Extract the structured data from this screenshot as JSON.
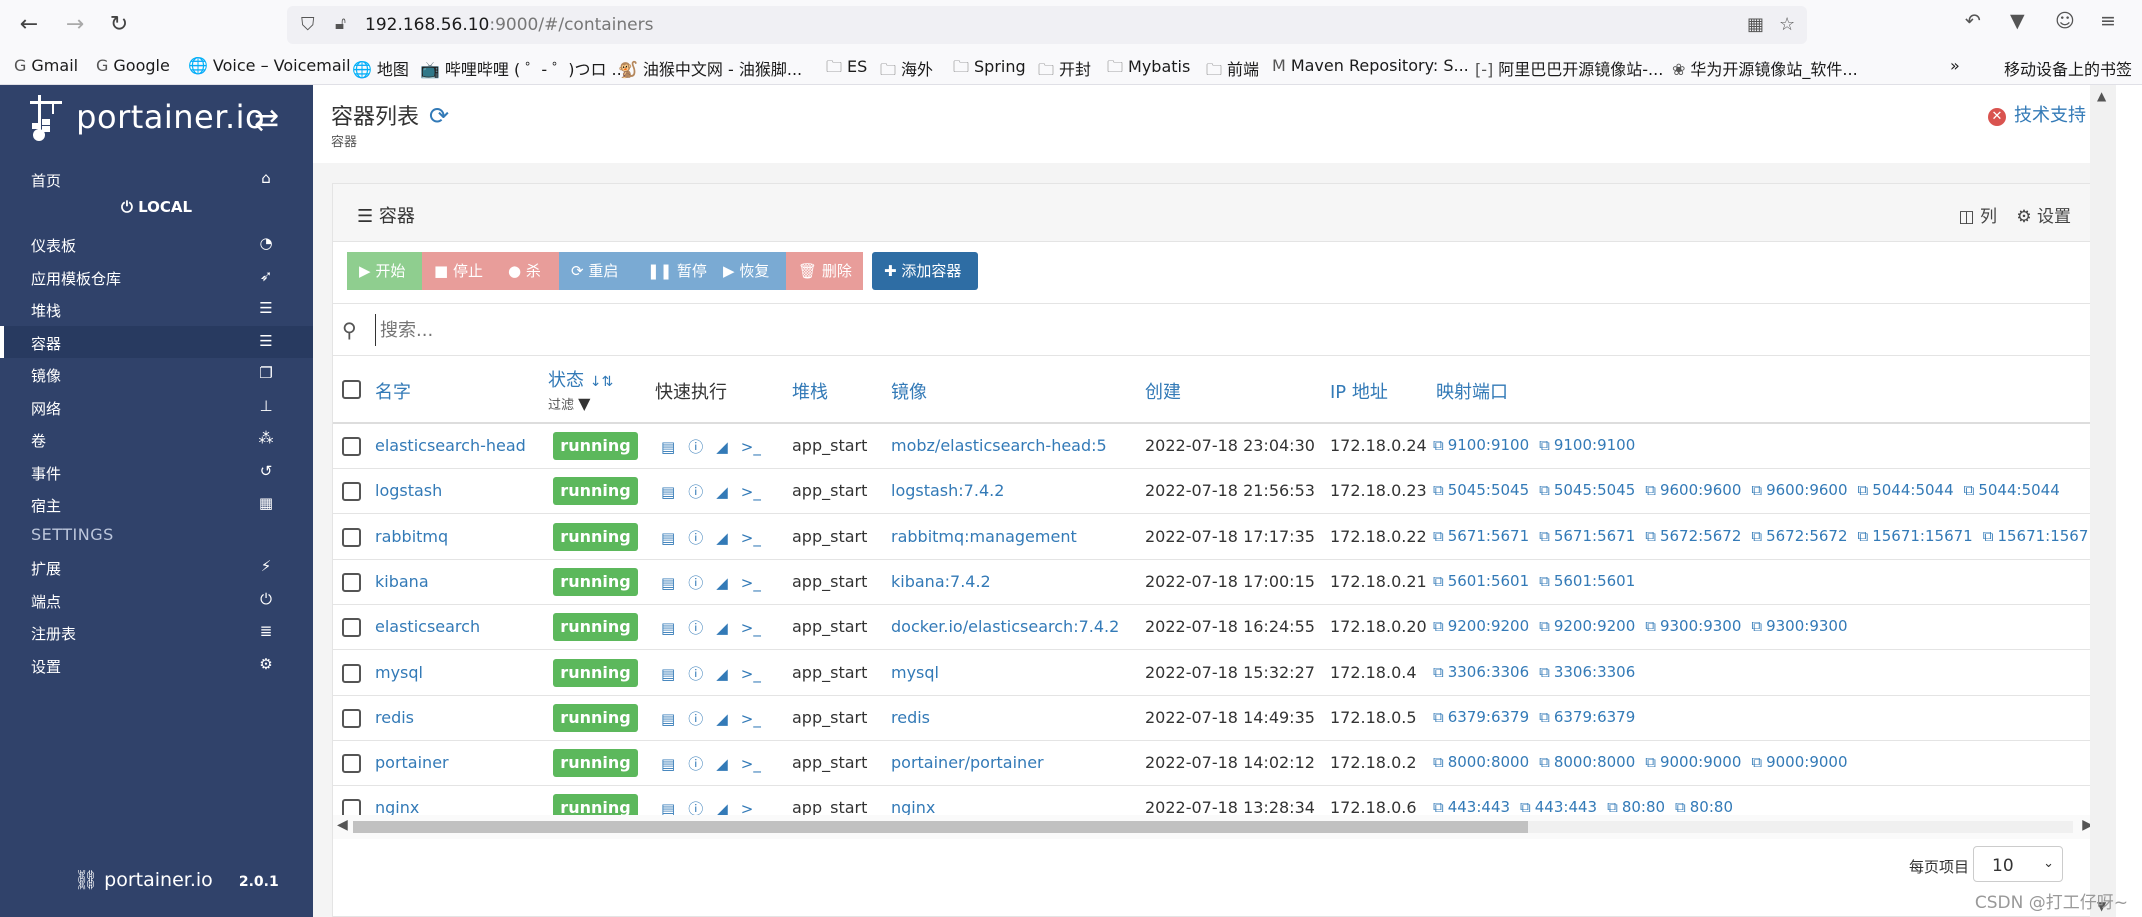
{
  "browser": {
    "url_host": "192.168.56.10",
    "url_rest": ":9000/#/containers",
    "bookmarks": [
      {
        "label": "Gmail",
        "icon": "G"
      },
      {
        "label": "Google",
        "icon": "G"
      },
      {
        "label": "Voice – Voicemail",
        "icon": "🌐"
      },
      {
        "label": "地图",
        "icon": "🌐"
      },
      {
        "label": "哔哩哔哩 ( ゜- ゜)つロ ...",
        "icon": "📺"
      },
      {
        "label": "油猴中文网 - 油猴脚...",
        "icon": "🐒"
      },
      {
        "label": "ES",
        "icon": "🗀"
      },
      {
        "label": "海外",
        "icon": "🗀"
      },
      {
        "label": "Spring",
        "icon": "🗀"
      },
      {
        "label": "开封",
        "icon": "🗀"
      },
      {
        "label": "Mybatis",
        "icon": "🗀"
      },
      {
        "label": "前端",
        "icon": "🗀"
      },
      {
        "label": "Maven Repository: S...",
        "icon": "M"
      },
      {
        "label": "阿里巴巴开源镜像站-...",
        "icon": "[-]"
      },
      {
        "label": "华为开源镜像站_软件...",
        "icon": "❀"
      }
    ],
    "mobile_bookmarks": "移动设备上的书签"
  },
  "sidebar": {
    "logo_text": "portainer.io",
    "home": "首页",
    "endpoint": "LOCAL",
    "items": [
      {
        "label": "仪表板",
        "icon": "dashboard-icon"
      },
      {
        "label": "应用模板仓库",
        "icon": "rocket-icon"
      },
      {
        "label": "堆栈",
        "icon": "list-icon"
      },
      {
        "label": "容器",
        "icon": "server-icon"
      },
      {
        "label": "镜像",
        "icon": "clone-icon"
      },
      {
        "label": "网络",
        "icon": "sitemap-icon"
      },
      {
        "label": "卷",
        "icon": "cubes-icon"
      },
      {
        "label": "事件",
        "icon": "history-icon"
      },
      {
        "label": "宿主",
        "icon": "th-icon"
      }
    ],
    "settings_heading": "SETTINGS",
    "settings_items": [
      {
        "label": "扩展",
        "icon": "bolt-icon"
      },
      {
        "label": "端点",
        "icon": "plug-icon"
      },
      {
        "label": "注册表",
        "icon": "database-icon"
      },
      {
        "label": "设置",
        "icon": "cogs-icon"
      }
    ],
    "footer_logo": "portainer.io",
    "version": "2.0.1"
  },
  "header": {
    "title": "容器列表",
    "subtitle": "容器",
    "support": "技术支持"
  },
  "panel": {
    "title": "容器",
    "columns_btn": "列",
    "settings_btn": "设置",
    "buttons": {
      "start": "开始",
      "stop": "停止",
      "kill": "杀",
      "restart": "重启",
      "pause": "暂停",
      "resume": "恢复",
      "remove": "删除",
      "add": "添加容器"
    },
    "search_placeholder": "搜索...",
    "headers": {
      "name": "名字",
      "state": "状态",
      "filter": "过滤",
      "quick": "快速执行",
      "stack": "堆栈",
      "image": "镜像",
      "created": "创建",
      "ip": "IP 地址",
      "ports": "映射端口"
    },
    "rows": [
      {
        "name": "elasticsearch-head",
        "state": "running",
        "stack": "app_start",
        "image": "mobz/elasticsearch-head:5",
        "created": "2022-07-18 23:04:30",
        "ip": "172.18.0.24",
        "ports": [
          "9100:9100",
          "9100:9100"
        ]
      },
      {
        "name": "logstash",
        "state": "running",
        "stack": "app_start",
        "image": "logstash:7.4.2",
        "created": "2022-07-18 21:56:53",
        "ip": "172.18.0.23",
        "ports": [
          "5045:5045",
          "5045:5045",
          "9600:9600",
          "9600:9600",
          "5044:5044",
          "5044:5044"
        ]
      },
      {
        "name": "rabbitmq",
        "state": "running",
        "stack": "app_start",
        "image": "rabbitmq:management",
        "created": "2022-07-18 17:17:35",
        "ip": "172.18.0.22",
        "ports": [
          "5671:5671",
          "5671:5671",
          "5672:5672",
          "5672:5672",
          "15671:15671",
          "15671:15671",
          "15"
        ]
      },
      {
        "name": "kibana",
        "state": "running",
        "stack": "app_start",
        "image": "kibana:7.4.2",
        "created": "2022-07-18 17:00:15",
        "ip": "172.18.0.21",
        "ports": [
          "5601:5601",
          "5601:5601"
        ]
      },
      {
        "name": "elasticsearch",
        "state": "running",
        "stack": "app_start",
        "image": "docker.io/elasticsearch:7.4.2",
        "created": "2022-07-18 16:24:55",
        "ip": "172.18.0.20",
        "ports": [
          "9200:9200",
          "9200:9200",
          "9300:9300",
          "9300:9300"
        ]
      },
      {
        "name": "mysql",
        "state": "running",
        "stack": "app_start",
        "image": "mysql",
        "created": "2022-07-18 15:32:27",
        "ip": "172.18.0.4",
        "ports": [
          "3306:3306",
          "3306:3306"
        ]
      },
      {
        "name": "redis",
        "state": "running",
        "stack": "app_start",
        "image": "redis",
        "created": "2022-07-18 14:49:35",
        "ip": "172.18.0.5",
        "ports": [
          "6379:6379",
          "6379:6379"
        ]
      },
      {
        "name": "portainer",
        "state": "running",
        "stack": "app_start",
        "image": "portainer/portainer",
        "created": "2022-07-18 14:02:12",
        "ip": "172.18.0.2",
        "ports": [
          "8000:8000",
          "8000:8000",
          "9000:9000",
          "9000:9000"
        ]
      },
      {
        "name": "nginx",
        "state": "running",
        "stack": "app_start",
        "image": "nginx",
        "created": "2022-07-18 13:28:34",
        "ip": "172.18.0.6",
        "ports": [
          "443:443",
          "443:443",
          "80:80",
          "80:80"
        ]
      }
    ],
    "per_page_label": "每页项目",
    "per_page_value": "10"
  },
  "watermark": "CSDN @打工仔呀~"
}
